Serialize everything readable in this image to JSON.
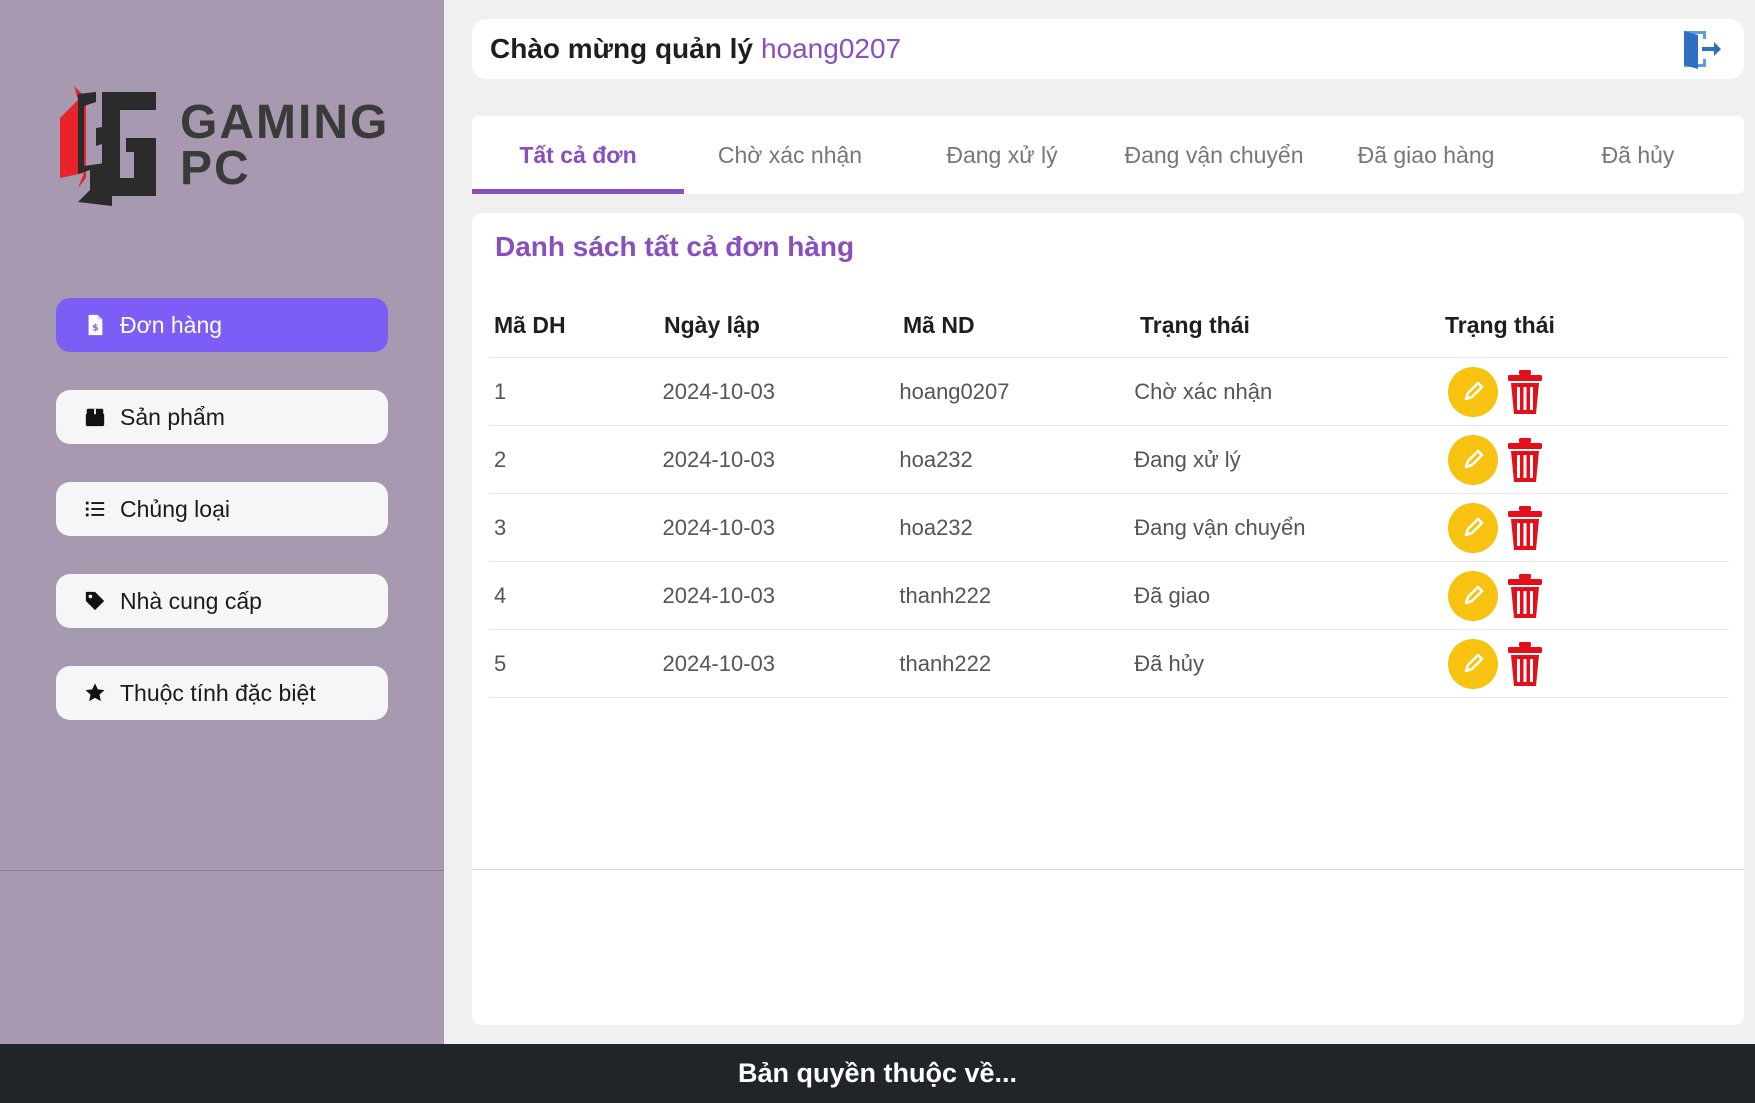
{
  "sidebar": {
    "logo": {
      "mark": "SG",
      "line1": "GAMING",
      "line2": "PC"
    },
    "items": [
      {
        "label": "Đơn hàng",
        "icon": "invoice-icon",
        "active": true
      },
      {
        "label": "Sản phẩm",
        "icon": "box-icon",
        "active": false
      },
      {
        "label": "Chủng loại",
        "icon": "list-icon",
        "active": false
      },
      {
        "label": "Nhà cung cấp",
        "icon": "tag-icon",
        "active": false
      },
      {
        "label": "Thuộc tính đặc biệt",
        "icon": "star-icon",
        "active": false
      }
    ]
  },
  "header": {
    "greeting": "Chào mừng quản lý",
    "username": "hoang0207",
    "logout_icon": "logout-icon"
  },
  "tabs": [
    {
      "label": "Tất cả đơn",
      "active": true
    },
    {
      "label": "Chờ xác nhận",
      "active": false
    },
    {
      "label": "Đang xử lý",
      "active": false
    },
    {
      "label": "Đang vận chuyển",
      "active": false
    },
    {
      "label": "Đã giao hàng",
      "active": false
    },
    {
      "label": "Đã hủy",
      "active": false
    }
  ],
  "panel": {
    "title": "Danh sách tất cả đơn hàng",
    "columns": [
      "Mã DH",
      "Ngày lập",
      "Mã ND",
      "Trạng thái",
      "Trạng thái"
    ],
    "rows": [
      {
        "id": "1",
        "date": "2024-10-03",
        "user": "hoang0207",
        "status": "Chờ xác nhận"
      },
      {
        "id": "2",
        "date": "2024-10-03",
        "user": "hoa232",
        "status": "Đang xử lý"
      },
      {
        "id": "3",
        "date": "2024-10-03",
        "user": "hoa232",
        "status": "Đang vận chuyển"
      },
      {
        "id": "4",
        "date": "2024-10-03",
        "user": "thanh222",
        "status": "Đã giao"
      },
      {
        "id": "5",
        "date": "2024-10-03",
        "user": "thanh222",
        "status": "Đã hủy"
      }
    ]
  },
  "footer": {
    "text": "Bản quyền thuộc về..."
  },
  "colors": {
    "sidebar_bg": "#a699b0",
    "accent_purple": "#8a4fbf",
    "active_nav": "#7c5ef7",
    "edit_yellow": "#f8c210",
    "delete_red": "#e3101b",
    "footer_bg": "#212529"
  }
}
